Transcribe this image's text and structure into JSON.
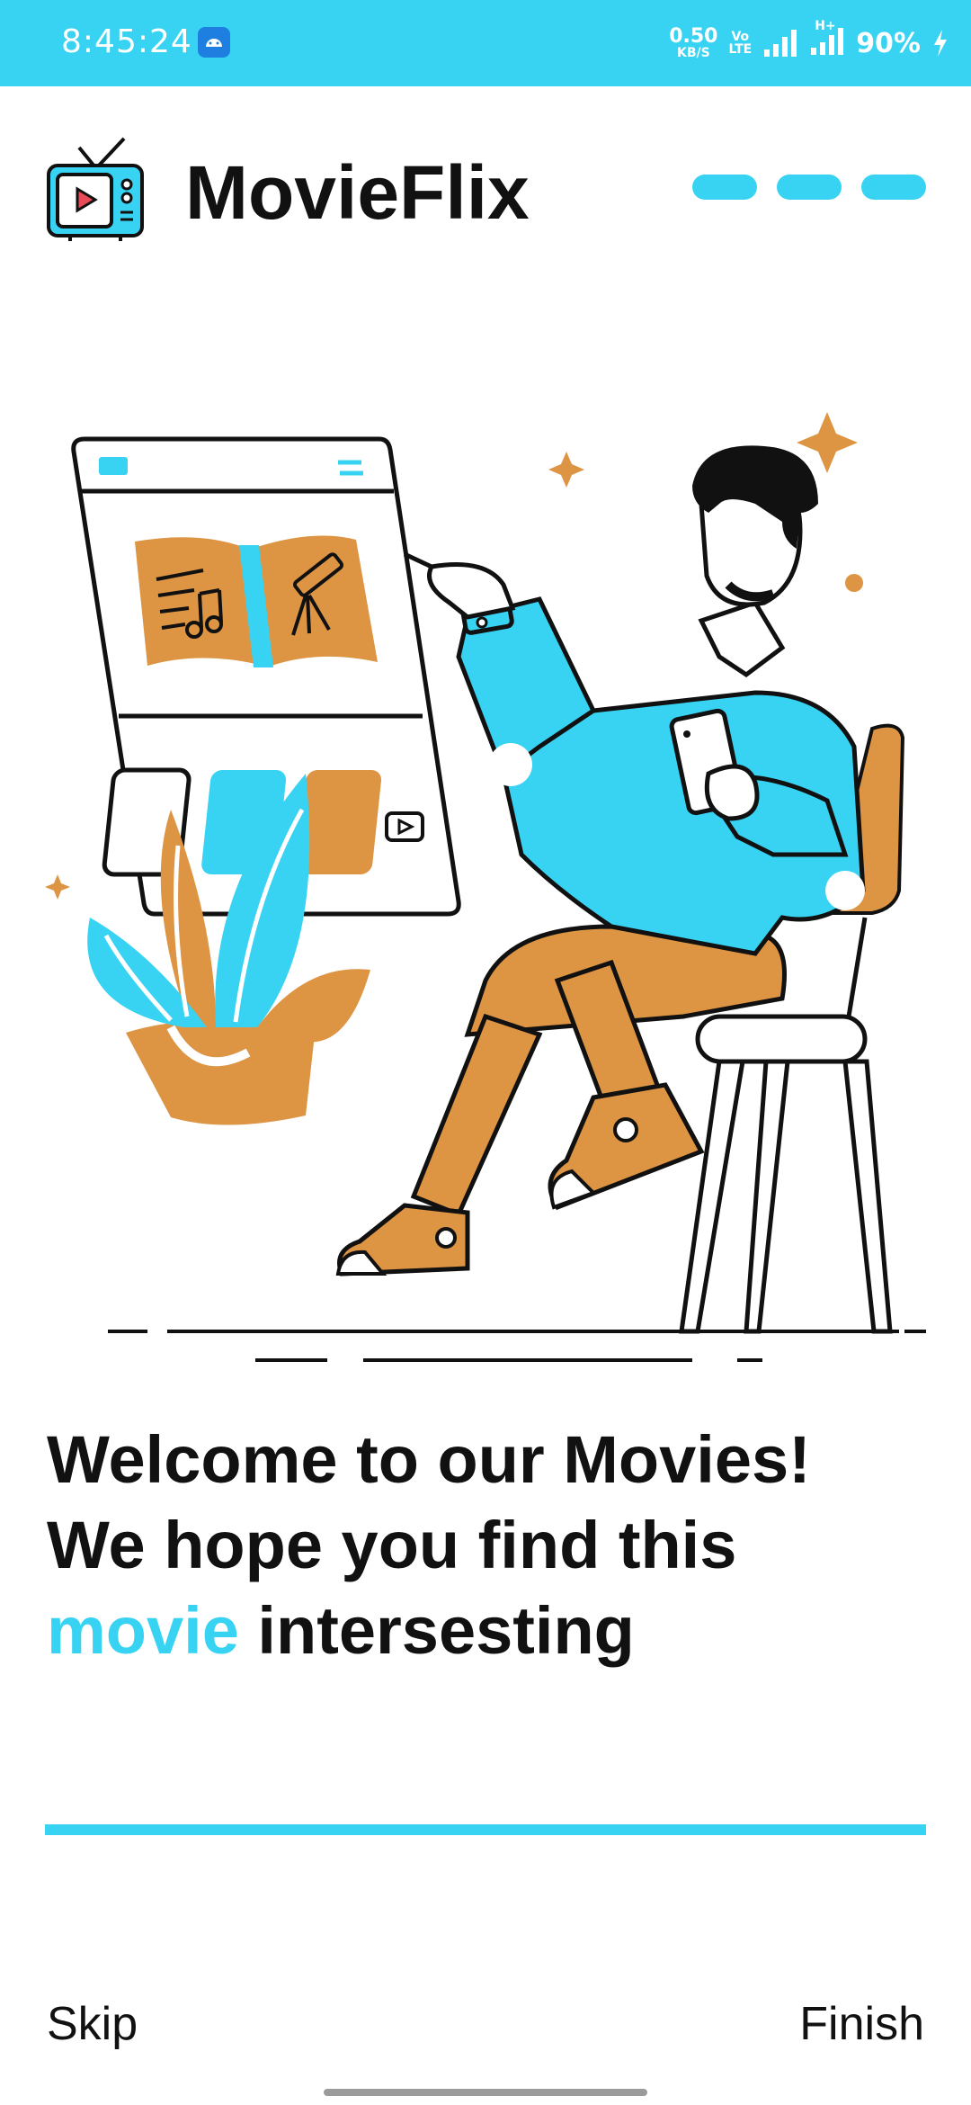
{
  "status_bar": {
    "time": "8:45:24",
    "net_speed_value": "0.50",
    "net_speed_unit": "KB/S",
    "volte_top": "Vo",
    "volte_bottom": "LTE",
    "network_type": "H+",
    "battery": "90%"
  },
  "header": {
    "app_title": "MovieFlix",
    "logo_icon": "tv-icon"
  },
  "onboarding": {
    "page_dots": 3,
    "illustration_icon": "person-browsing-media-illustration",
    "welcome_text_part1": "Welcome to our Movies! We hope you find this ",
    "welcome_text_highlight": "movie",
    "welcome_text_part2": " intersesting"
  },
  "footer": {
    "skip_label": "Skip",
    "finish_label": "Finish"
  },
  "colors": {
    "accent": "#38d3f3",
    "orange": "#dd9443",
    "text": "#111111"
  }
}
